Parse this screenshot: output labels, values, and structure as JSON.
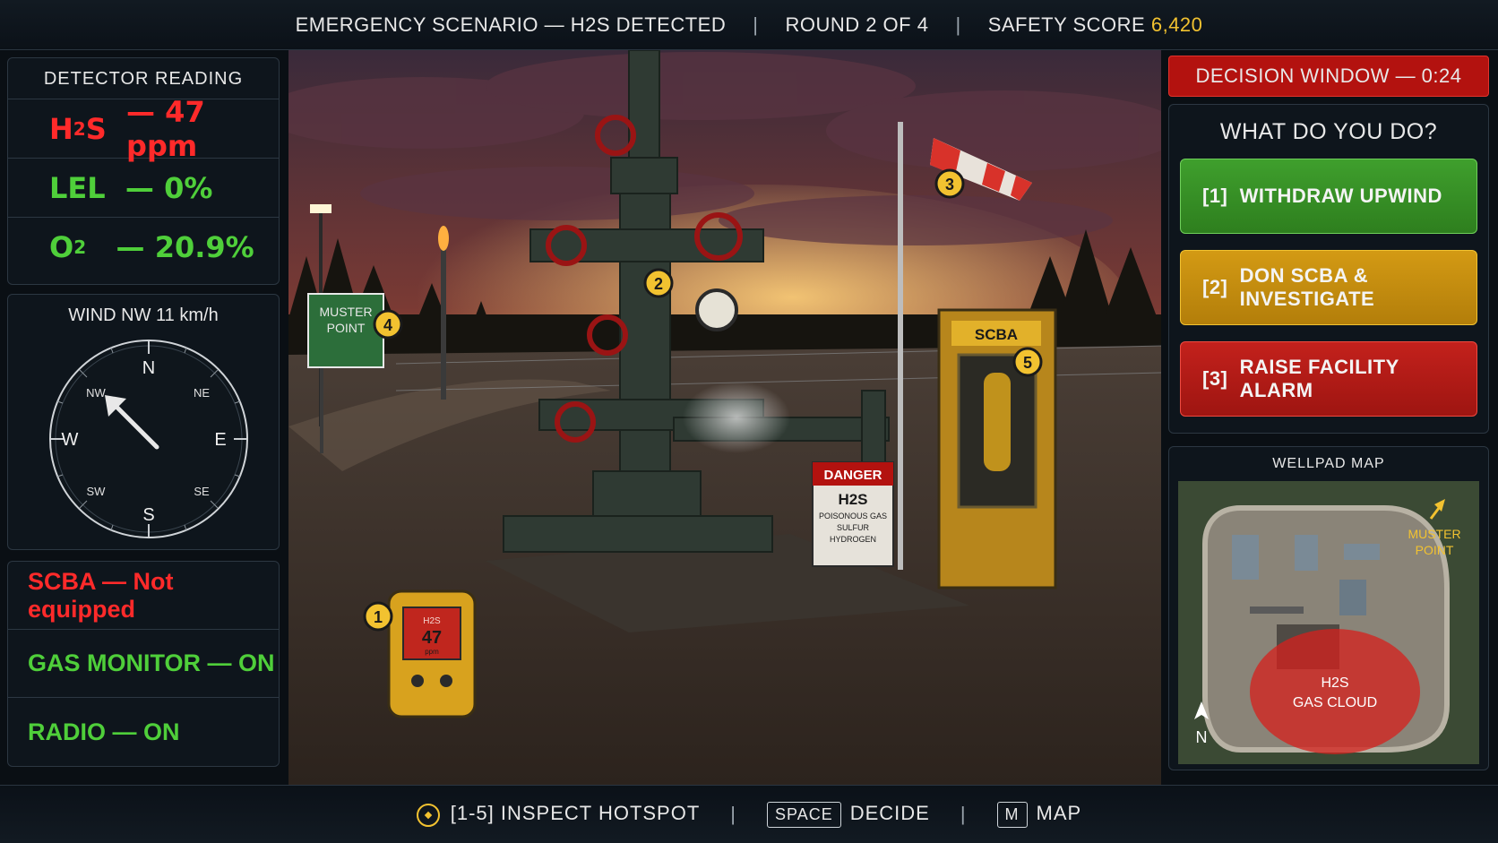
{
  "header": {
    "scenario": "EMERGENCY SCENARIO — H2S DETECTED",
    "round": "ROUND 2 OF 4",
    "score_label": "SAFETY SCORE",
    "score_value": "6,420"
  },
  "detector": {
    "title": "DETECTOR READING",
    "readings": [
      {
        "label_main": "H",
        "label_sub": "2",
        "label_tail": "S",
        "value": "— 47 ppm",
        "color": "#ff2a2a"
      },
      {
        "label_main": "LEL",
        "label_sub": "",
        "label_tail": "",
        "value": "— 0%",
        "color": "#4fcf3a"
      },
      {
        "label_main": "O",
        "label_sub": "2",
        "label_tail": "",
        "value": "— 20.9%",
        "color": "#4fcf3a"
      }
    ]
  },
  "wind": {
    "title": "WIND NW 11 km/h",
    "cardinals": {
      "n": "N",
      "s": "S",
      "e": "E",
      "w": "W",
      "nw": "NW",
      "ne": "NE",
      "sw": "SW",
      "se": "SE"
    }
  },
  "status": {
    "scba": "SCBA — Not equipped",
    "gas_monitor": "GAS MONITOR — ON",
    "radio": "RADIO — ON"
  },
  "scene": {
    "muster_sign": [
      "MUSTER",
      "POINT"
    ],
    "scba_cabinet": "SCBA",
    "danger_sign": {
      "title": "DANGER",
      "gas": "H2S",
      "line1": "POISONOUS GAS",
      "line2": "SULFUR",
      "line3": "HYDROGEN"
    },
    "detector_device": {
      "gas": "H2S",
      "value": "47",
      "unit": "ppm"
    },
    "hotspots": [
      "1",
      "2",
      "3",
      "4",
      "5"
    ]
  },
  "decision": {
    "timer": "DECISION WINDOW — 0:24",
    "question": "WHAT DO YOU DO?",
    "choices": [
      {
        "key": "[1]",
        "label": "WITHDRAW UPWIND"
      },
      {
        "key": "[2]",
        "label": "DON SCBA & INVESTIGATE"
      },
      {
        "key": "[3]",
        "label": "RAISE FACILITY ALARM"
      }
    ]
  },
  "map": {
    "title": "WELLPAD MAP",
    "muster": [
      "MUSTER",
      "POINT"
    ],
    "cloud": [
      "H2S",
      "GAS CLOUD"
    ],
    "north": "N"
  },
  "controls": {
    "inspect": "[1-5] INSPECT HOTSPOT",
    "space_key": "SPACE",
    "space_label": "DECIDE",
    "map_key": "M",
    "map_label": "MAP"
  },
  "colors": {
    "danger": "#ff2a2a",
    "ok": "#4fcf3a",
    "accent": "#f2c230",
    "timer_bg": "#b3120f"
  }
}
